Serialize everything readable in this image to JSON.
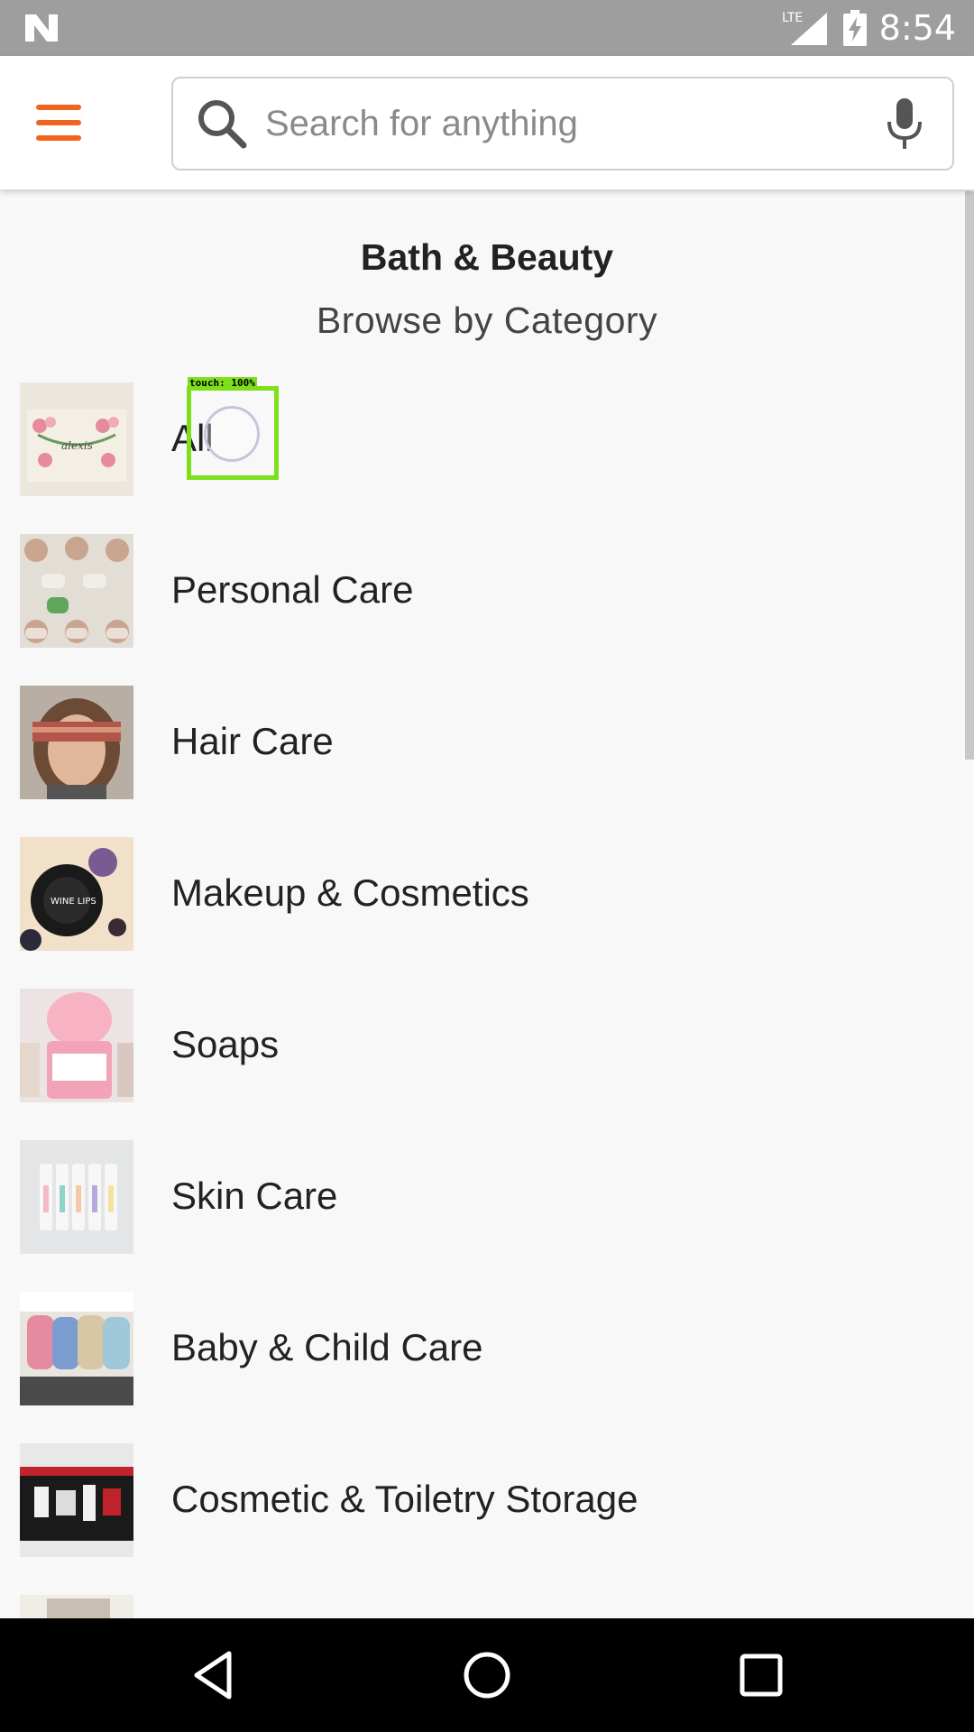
{
  "status_bar": {
    "time": "8:54",
    "network": "LTE",
    "icons": [
      "n-logo-icon",
      "lte-signal-icon",
      "battery-charging-icon"
    ]
  },
  "app_bar": {
    "menu_icon": "hamburger-menu-icon",
    "search_placeholder": "Search for anything",
    "search_value": "",
    "mic_icon": "microphone-icon",
    "accent_color": "#f1641e"
  },
  "section": {
    "title": "Bath & Beauty",
    "subtitle": "Browse by Category"
  },
  "categories": [
    {
      "label": "All"
    },
    {
      "label": "Personal Care"
    },
    {
      "label": "Hair Care"
    },
    {
      "label": "Makeup & Cosmetics"
    },
    {
      "label": "Soaps"
    },
    {
      "label": "Skin Care"
    },
    {
      "label": "Baby & Child Care"
    },
    {
      "label": "Cosmetic & Toiletry Storage"
    },
    {
      "label": ""
    }
  ],
  "touch_overlay": {
    "label": "touch: 100%",
    "color": "#7ee01a"
  },
  "nav_bar": {
    "icons": [
      "back-icon",
      "home-icon",
      "recent-apps-icon"
    ]
  }
}
